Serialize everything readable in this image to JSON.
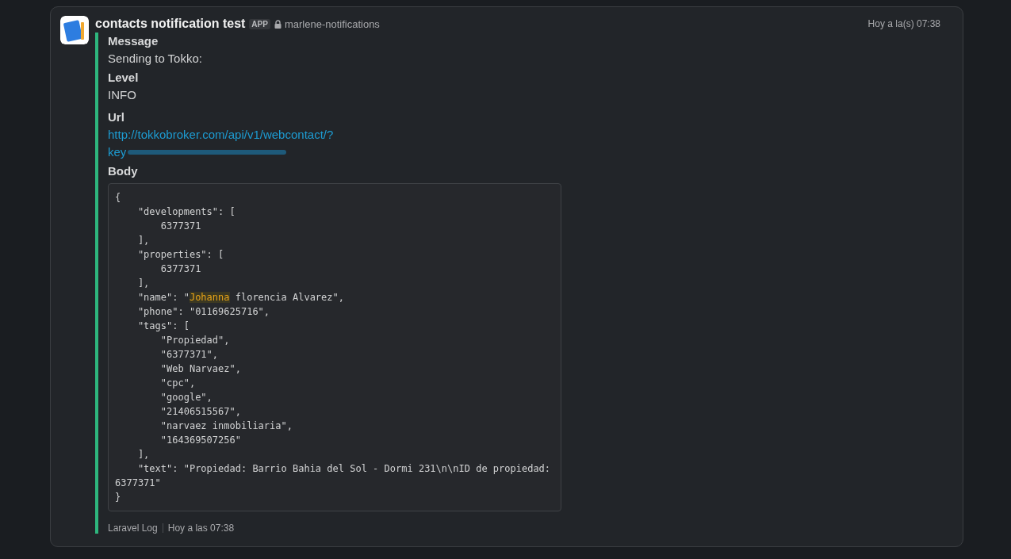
{
  "message": {
    "sender": "contacts notification test",
    "badge": "APP",
    "channel": "marlene-notifications",
    "time": "Hoy a la(s) 07:38"
  },
  "attachment": {
    "color": "#2eb67d",
    "fields": [
      {
        "kind": "text",
        "title": "Message",
        "value": "Sending to Tokko:"
      },
      {
        "kind": "text",
        "title": "Level",
        "value": "INFO"
      },
      {
        "kind": "link",
        "title": "Url",
        "lines": [
          "http://tokkobroker.com/api/v1/webcontact/?",
          "key"
        ]
      },
      {
        "kind": "code",
        "title": "Body",
        "lines": [
          {
            "parts": [
              {
                "text": "{",
                "highlighted": false
              }
            ]
          },
          {
            "parts": [
              {
                "text": "    \"developments\": [",
                "highlighted": false
              }
            ]
          },
          {
            "parts": [
              {
                "text": "        6377371",
                "highlighted": false
              }
            ]
          },
          {
            "parts": [
              {
                "text": "    ],",
                "highlighted": false
              }
            ]
          },
          {
            "parts": [
              {
                "text": "    \"properties\": [",
                "highlighted": false
              }
            ]
          },
          {
            "parts": [
              {
                "text": "        6377371",
                "highlighted": false
              }
            ]
          },
          {
            "parts": [
              {
                "text": "    ],",
                "highlighted": false
              }
            ]
          },
          {
            "parts": [
              {
                "text": "    \"name\": \"",
                "highlighted": false
              },
              {
                "text": "Johanna",
                "highlighted": true
              },
              {
                "text": " florencia Alvarez\",",
                "highlighted": false
              }
            ]
          },
          {
            "parts": [
              {
                "text": "    \"phone\": \"01169625716\",",
                "highlighted": false
              }
            ]
          },
          {
            "parts": [
              {
                "text": "    \"tags\": [",
                "highlighted": false
              }
            ]
          },
          {
            "parts": [
              {
                "text": "        \"Propiedad\",",
                "highlighted": false
              }
            ]
          },
          {
            "parts": [
              {
                "text": "        \"6377371\",",
                "highlighted": false
              }
            ]
          },
          {
            "parts": [
              {
                "text": "        \"Web Narvaez\",",
                "highlighted": false
              }
            ]
          },
          {
            "parts": [
              {
                "text": "        \"cpc\",",
                "highlighted": false
              }
            ]
          },
          {
            "parts": [
              {
                "text": "        \"google\",",
                "highlighted": false
              }
            ]
          },
          {
            "parts": [
              {
                "text": "        \"21406515567\",",
                "highlighted": false
              }
            ]
          },
          {
            "parts": [
              {
                "text": "        \"narvaez inmobiliaria\",",
                "highlighted": false
              }
            ]
          },
          {
            "parts": [
              {
                "text": "        \"164369507256\"",
                "highlighted": false
              }
            ]
          },
          {
            "parts": [
              {
                "text": "    ],",
                "highlighted": false
              }
            ]
          },
          {
            "parts": [
              {
                "text": "    \"text\": \"Propiedad: Barrio Bahia del Sol - Dormi 231\\n\\nID de propiedad:",
                "highlighted": false
              }
            ]
          },
          {
            "parts": [
              {
                "text": "6377371\"",
                "highlighted": false
              }
            ]
          },
          {
            "parts": [
              {
                "text": "}",
                "highlighted": false
              }
            ]
          }
        ]
      }
    ],
    "footer": {
      "source": "Laravel Log",
      "time": "Hoy a las 07:38"
    }
  }
}
